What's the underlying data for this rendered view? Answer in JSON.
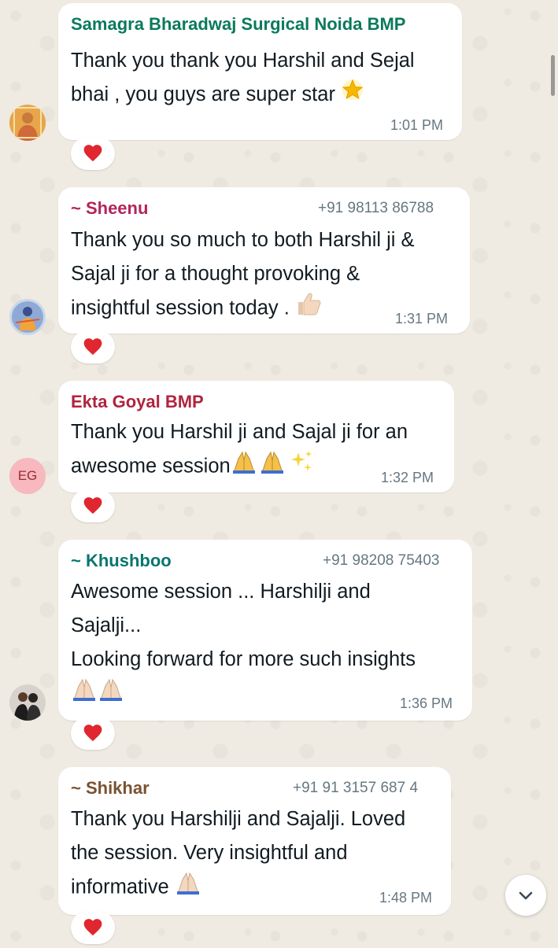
{
  "colors": {
    "chat_background": "#efeae2",
    "bubble": "#ffffff",
    "timestamp": "#667781",
    "reaction_heart": "#e0262e"
  },
  "messages": [
    {
      "sender": "Samagra Bharadwaj Surgical Noida BMP",
      "sender_color": "#0b7a5c",
      "phone": "",
      "lines": [
        "Thank you thank you Harshil and Sejal",
        "bhai , you guys are super star"
      ],
      "trailing_emoji": "glowing-star-icon",
      "time": "1:01 PM",
      "avatar": "profile-photo",
      "reaction": "red-heart-icon"
    },
    {
      "sender": "~ Sheenu",
      "sender_color": "#b3245a",
      "phone": "+91 98113 86788",
      "lines": [
        "Thank you so much to both Harshil ji &",
        "Sajal ji for a thought provoking &",
        "insightful session today ."
      ],
      "trailing_emoji": "thumbs-up-icon",
      "time": "1:31 PM",
      "avatar": "profile-photo",
      "reaction": "red-heart-icon"
    },
    {
      "sender": "Ekta Goyal BMP",
      "sender_color": "#b0243f",
      "phone": "",
      "lines": [
        "Thank you Harshil ji and Sajal ji for an",
        "awesome session"
      ],
      "trailing_emoji": "folded-hands-sparkles-icon",
      "time": "1:32 PM",
      "avatar_initials": "EG",
      "reaction": "red-heart-icon"
    },
    {
      "sender": "~ Khushboo",
      "sender_color": "#07766f",
      "phone": "+91 98208 75403",
      "lines": [
        "Awesome session ... Harshilji and",
        "Sajalji...",
        "Looking forward for more such insights"
      ],
      "trailing_emoji": "folded-hands-icon",
      "time": "1:36 PM",
      "avatar": "profile-photo",
      "reaction": "red-heart-icon"
    },
    {
      "sender": "~ Shikhar",
      "sender_color": "#7a5230",
      "phone": "+91 91 3157 687 4",
      "lines": [
        "Thank you Harshilji and Sajalji. Loved",
        "the session. Very insightful and",
        "informative"
      ],
      "trailing_emoji": "folded-hands-icon",
      "time": "1:48 PM",
      "avatar": "",
      "reaction": "red-heart-icon"
    }
  ],
  "scroll_down_button": "chevron-down-icon"
}
